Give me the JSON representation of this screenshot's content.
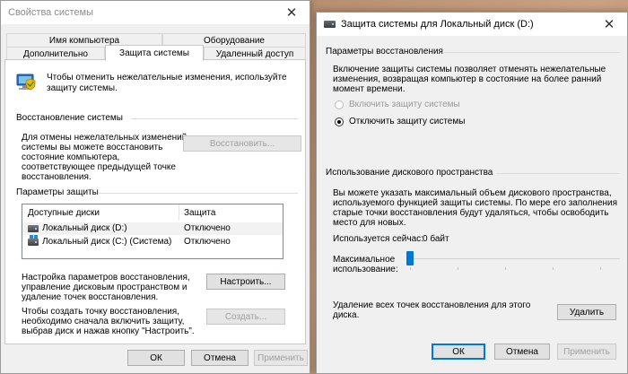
{
  "left_window": {
    "title": "Свойства системы",
    "tabs_top": [
      "Имя компьютера",
      "Оборудование"
    ],
    "tabs_bottom": [
      "Дополнительно",
      "Защита системы",
      "Удаленный доступ"
    ],
    "intro": [
      "Чтобы отменить нежелательные изменения, используйте",
      "защиту системы."
    ],
    "restore_heading": "Восстановление системы",
    "restore_desc": [
      "Для отмены нежелательных изменений",
      "системы вы можете восстановить",
      "состояние компьютера,",
      "соответствующее предыдущей точке",
      "восстановления."
    ],
    "restore_button": "Восстановить...",
    "protection_heading": "Параметры защиты",
    "table_headers": [
      "Доступные диски",
      "Защита"
    ],
    "drives": [
      {
        "name": "Локальный диск (D:)",
        "status": "Отключено"
      },
      {
        "name": "Локальный диск (C:) (Система)",
        "status": "Отключено"
      }
    ],
    "configure_desc": [
      "Настройка параметров восстановления,",
      "управление дисковым пространством и",
      "удаление точек восстановления."
    ],
    "configure_button": "Настроить...",
    "create_desc": [
      "Чтобы создать точку восстановления,",
      "необходимо сначала включить защиту,",
      "выбрав диск и нажав кнопку \"Настроить\"."
    ],
    "create_button": "Создать...",
    "ok": "ОК",
    "cancel": "Отмена",
    "apply": "Применить"
  },
  "right_window": {
    "title": "Защита системы для Локальный диск (D:)",
    "restore_params_heading": "Параметры восстановления",
    "restore_params_desc": [
      "Включение защиты системы позволяет отменять нежелательные",
      "изменения, возвращая компьютер в состояние на более ранний",
      "момент времени."
    ],
    "radio_enable": "Включить защиту системы",
    "radio_disable": "Отключить защиту системы",
    "disk_usage_heading": "Использование дискового пространства",
    "disk_usage_desc": [
      "Вы можете указать максимальный объем дискового пространства,",
      "используемого функцией защиты системы. По мере его заполнения",
      "старые точки восстановления будут удаляться, чтобы освободить",
      "место для новых."
    ],
    "current_usage_label": "Используется сейчас:",
    "current_usage_value": "0 байт",
    "max_usage_label": [
      "Максимальное",
      "использование:"
    ],
    "max_usage_fraction": 0,
    "delete_desc": [
      "Удаление всех точек восстановления для этого",
      "диска."
    ],
    "delete_button": "Удалить",
    "ok": "ОК",
    "cancel": "Отмена",
    "apply": "Применить"
  },
  "colors": {
    "accent": "#0078d7",
    "disabled_text": "#a0a0a0"
  },
  "icons": {
    "close": "close-icon",
    "system_protection": "computer-shield-icon",
    "drive": "drive-icon",
    "system_drive": "windows-drive-icon"
  }
}
